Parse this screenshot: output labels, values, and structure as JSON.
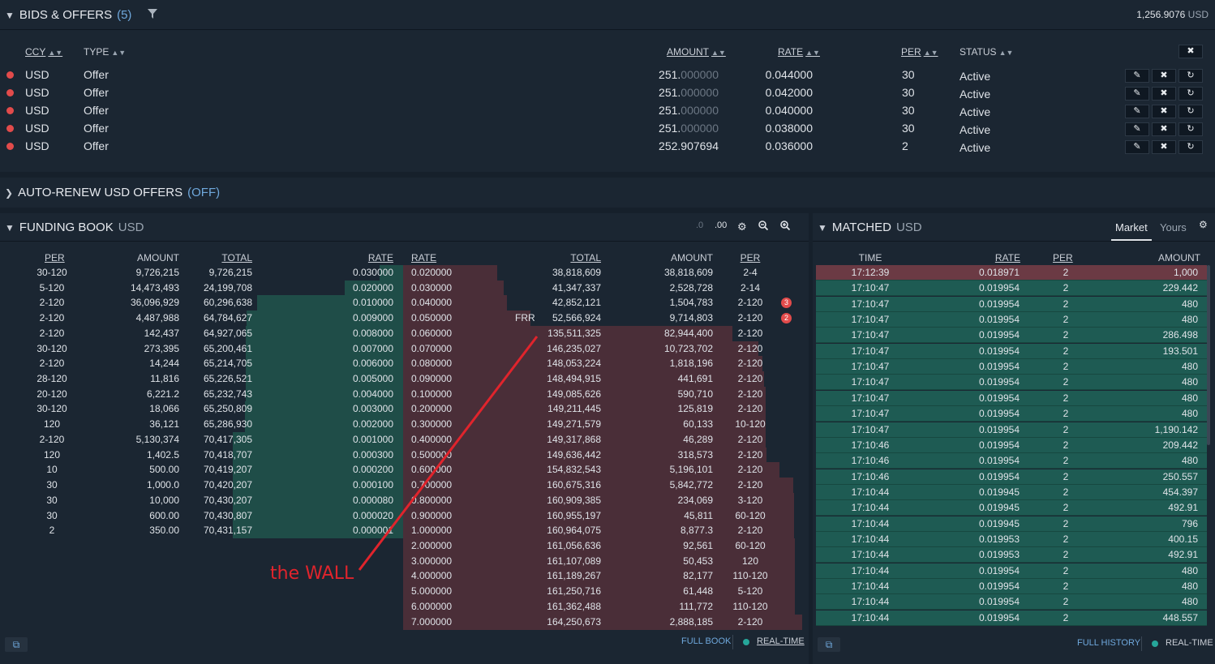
{
  "bids_offers": {
    "title": "BIDS & OFFERS",
    "count": "(5)",
    "balance": "1,256.9076",
    "balance_unit": "USD",
    "columns": {
      "ccy": "CCY",
      "type": "TYPE",
      "amount": "AMOUNT",
      "rate": "RATE",
      "per": "PER",
      "status": "STATUS"
    },
    "rows": [
      {
        "ccy": "USD",
        "type": "Offer",
        "amount_int": "251.",
        "amount_dec": "000000",
        "rate": "0.044000",
        "per": "30",
        "status": "Active"
      },
      {
        "ccy": "USD",
        "type": "Offer",
        "amount_int": "251.",
        "amount_dec": "000000",
        "rate": "0.042000",
        "per": "30",
        "status": "Active"
      },
      {
        "ccy": "USD",
        "type": "Offer",
        "amount_int": "251.",
        "amount_dec": "000000",
        "rate": "0.040000",
        "per": "30",
        "status": "Active"
      },
      {
        "ccy": "USD",
        "type": "Offer",
        "amount_int": "251.",
        "amount_dec": "000000",
        "rate": "0.038000",
        "per": "30",
        "status": "Active"
      },
      {
        "ccy": "USD",
        "type": "Offer",
        "amount_int": "252.907694",
        "amount_dec": "",
        "rate": "0.036000",
        "per": "2",
        "status": "Active"
      }
    ]
  },
  "auto_renew": {
    "title": "AUTO-RENEW USD OFFERS",
    "state": "(OFF)"
  },
  "funding_book": {
    "title": "FUNDING BOOK",
    "currency": "USD",
    "precision_minus": ".0",
    "precision_plus": ".00",
    "bid_columns": {
      "per": "PER",
      "amount": "AMOUNT",
      "total": "TOTAL",
      "rate": "RATE"
    },
    "ask_columns": {
      "rate": "RATE",
      "total": "TOTAL",
      "amount": "AMOUNT",
      "per": "PER"
    },
    "bids": [
      {
        "per": "30-120",
        "amount": "9,726,215",
        "total": "9,726,215",
        "rate": "0.030000",
        "depth": 0.138
      },
      {
        "per": "5-120",
        "amount": "14,473,493",
        "total": "24,199,708",
        "rate": "0.020000",
        "depth": 0.344
      },
      {
        "per": "2-120",
        "amount": "36,096,929",
        "total": "60,296,638",
        "rate": "0.010000",
        "depth": 0.856
      },
      {
        "per": "2-120",
        "amount": "4,487,988",
        "total": "64,784,627",
        "rate": "0.009000",
        "depth": 0.92
      },
      {
        "per": "2-120",
        "amount": "142,437",
        "total": "64,927,065",
        "rate": "0.008000",
        "depth": 0.922
      },
      {
        "per": "30-120",
        "amount": "273,395",
        "total": "65,200,461",
        "rate": "0.007000",
        "depth": 0.926
      },
      {
        "per": "2-120",
        "amount": "14,244",
        "total": "65,214,705",
        "rate": "0.006000",
        "depth": 0.926
      },
      {
        "per": "28-120",
        "amount": "11,816",
        "total": "65,226,521",
        "rate": "0.005000",
        "depth": 0.926
      },
      {
        "per": "20-120",
        "amount": "6,221.2",
        "total": "65,232,743",
        "rate": "0.004000",
        "depth": 0.926
      },
      {
        "per": "30-120",
        "amount": "18,066",
        "total": "65,250,809",
        "rate": "0.003000",
        "depth": 0.927
      },
      {
        "per": "120",
        "amount": "36,121",
        "total": "65,286,930",
        "rate": "0.002000",
        "depth": 0.927
      },
      {
        "per": "2-120",
        "amount": "5,130,374",
        "total": "70,417,305",
        "rate": "0.001000",
        "depth": 1.0
      },
      {
        "per": "120",
        "amount": "1,402.5",
        "total": "70,418,707",
        "rate": "0.000300",
        "depth": 1.0
      },
      {
        "per": "10",
        "amount": "500.00",
        "total": "70,419,207",
        "rate": "0.000200",
        "depth": 1.0
      },
      {
        "per": "30",
        "amount": "1,000.0",
        "total": "70,420,207",
        "rate": "0.000100",
        "depth": 1.0
      },
      {
        "per": "30",
        "amount": "10,000",
        "total": "70,430,207",
        "rate": "0.000080",
        "depth": 1.0
      },
      {
        "per": "30",
        "amount": "600.00",
        "total": "70,430,807",
        "rate": "0.000020",
        "depth": 1.0
      },
      {
        "per": "2",
        "amount": "350.00",
        "total": "70,431,157",
        "rate": "0.000001",
        "depth": 1.0
      }
    ],
    "asks": [
      {
        "rate": "0.020000",
        "total": "38,818,609",
        "amount": "38,818,609",
        "per": "2-4",
        "depth": 0.236,
        "frr": "",
        "badge": ""
      },
      {
        "rate": "0.030000",
        "total": "41,347,337",
        "amount": "2,528,728",
        "per": "2-14",
        "depth": 0.252,
        "frr": "",
        "badge": ""
      },
      {
        "rate": "0.040000",
        "total": "42,852,121",
        "amount": "1,504,783",
        "per": "2-120",
        "depth": 0.261,
        "frr": "",
        "badge": "3"
      },
      {
        "rate": "0.050000",
        "total": "52,566,924",
        "amount": "9,714,803",
        "per": "2-120",
        "depth": 0.32,
        "frr": "FRR",
        "badge": "2"
      },
      {
        "rate": "0.060000",
        "total": "135,511,325",
        "amount": "82,944,400",
        "per": "2-120",
        "depth": 0.825,
        "frr": "",
        "badge": ""
      },
      {
        "rate": "0.070000",
        "total": "146,235,027",
        "amount": "10,723,702",
        "per": "2-120",
        "depth": 0.89,
        "frr": "",
        "badge": ""
      },
      {
        "rate": "0.080000",
        "total": "148,053,224",
        "amount": "1,818,196",
        "per": "2-120",
        "depth": 0.901,
        "frr": "",
        "badge": ""
      },
      {
        "rate": "0.090000",
        "total": "148,494,915",
        "amount": "441,691",
        "per": "2-120",
        "depth": 0.904,
        "frr": "",
        "badge": ""
      },
      {
        "rate": "0.100000",
        "total": "149,085,626",
        "amount": "590,710",
        "per": "2-120",
        "depth": 0.908,
        "frr": "",
        "badge": ""
      },
      {
        "rate": "0.200000",
        "total": "149,211,445",
        "amount": "125,819",
        "per": "2-120",
        "depth": 0.908,
        "frr": "",
        "badge": ""
      },
      {
        "rate": "0.300000",
        "total": "149,271,579",
        "amount": "60,133",
        "per": "10-120",
        "depth": 0.909,
        "frr": "",
        "badge": ""
      },
      {
        "rate": "0.400000",
        "total": "149,317,868",
        "amount": "46,289",
        "per": "2-120",
        "depth": 0.909,
        "frr": "",
        "badge": ""
      },
      {
        "rate": "0.500000",
        "total": "149,636,442",
        "amount": "318,573",
        "per": "2-120",
        "depth": 0.911,
        "frr": "",
        "badge": ""
      },
      {
        "rate": "0.600000",
        "total": "154,832,543",
        "amount": "5,196,101",
        "per": "2-120",
        "depth": 0.943,
        "frr": "",
        "badge": ""
      },
      {
        "rate": "0.700000",
        "total": "160,675,316",
        "amount": "5,842,772",
        "per": "2-120",
        "depth": 0.978,
        "frr": "",
        "badge": ""
      },
      {
        "rate": "0.800000",
        "total": "160,909,385",
        "amount": "234,069",
        "per": "3-120",
        "depth": 0.98,
        "frr": "",
        "badge": ""
      },
      {
        "rate": "0.900000",
        "total": "160,955,197",
        "amount": "45,811",
        "per": "60-120",
        "depth": 0.98,
        "frr": "",
        "badge": ""
      },
      {
        "rate": "1.000000",
        "total": "160,964,075",
        "amount": "8,877.3",
        "per": "2-120",
        "depth": 0.98,
        "frr": "",
        "badge": ""
      },
      {
        "rate": "2.000000",
        "total": "161,056,636",
        "amount": "92,561",
        "per": "60-120",
        "depth": 0.981,
        "frr": "",
        "badge": ""
      },
      {
        "rate": "3.000000",
        "total": "161,107,089",
        "amount": "50,453",
        "per": "120",
        "depth": 0.981,
        "frr": "",
        "badge": ""
      },
      {
        "rate": "4.000000",
        "total": "161,189,267",
        "amount": "82,177",
        "per": "110-120",
        "depth": 0.981,
        "frr": "",
        "badge": ""
      },
      {
        "rate": "5.000000",
        "total": "161,250,716",
        "amount": "61,448",
        "per": "5-120",
        "depth": 0.982,
        "frr": "",
        "badge": ""
      },
      {
        "rate": "6.000000",
        "total": "161,362,488",
        "amount": "111,772",
        "per": "110-120",
        "depth": 0.982,
        "frr": "",
        "badge": ""
      },
      {
        "rate": "7.000000",
        "total": "164,250,673",
        "amount": "2,888,185",
        "per": "2-120",
        "depth": 1.0,
        "frr": "",
        "badge": ""
      }
    ],
    "annotation": "the WALL",
    "footer_full_book": "FULL BOOK",
    "footer_realtime": "REAL-TIME"
  },
  "matched": {
    "title": "MATCHED",
    "currency": "USD",
    "tab_market": "Market",
    "tab_yours": "Yours",
    "columns": {
      "time": "TIME",
      "rate": "RATE",
      "per": "PER",
      "amount": "AMOUNT"
    },
    "rows": [
      {
        "time": "17:12:39",
        "rate": "0.018971",
        "per": "2",
        "amount": "1,000",
        "side": "sell"
      },
      {
        "time": "17:10:47",
        "rate": "0.019954",
        "per": "2",
        "amount": "229.442",
        "side": "buy"
      },
      {
        "time": "17:10:47",
        "rate": "0.019954",
        "per": "2",
        "amount": "480",
        "side": "buy"
      },
      {
        "time": "17:10:47",
        "rate": "0.019954",
        "per": "2",
        "amount": "480",
        "side": "buy"
      },
      {
        "time": "17:10:47",
        "rate": "0.019954",
        "per": "2",
        "amount": "286.498",
        "side": "buy"
      },
      {
        "time": "17:10:47",
        "rate": "0.019954",
        "per": "2",
        "amount": "193.501",
        "side": "buy"
      },
      {
        "time": "17:10:47",
        "rate": "0.019954",
        "per": "2",
        "amount": "480",
        "side": "buy"
      },
      {
        "time": "17:10:47",
        "rate": "0.019954",
        "per": "2",
        "amount": "480",
        "side": "buy"
      },
      {
        "time": "17:10:47",
        "rate": "0.019954",
        "per": "2",
        "amount": "480",
        "side": "buy"
      },
      {
        "time": "17:10:47",
        "rate": "0.019954",
        "per": "2",
        "amount": "480",
        "side": "buy"
      },
      {
        "time": "17:10:47",
        "rate": "0.019954",
        "per": "2",
        "amount": "1,190.142",
        "side": "buy"
      },
      {
        "time": "17:10:46",
        "rate": "0.019954",
        "per": "2",
        "amount": "209.442",
        "side": "buy"
      },
      {
        "time": "17:10:46",
        "rate": "0.019954",
        "per": "2",
        "amount": "480",
        "side": "buy"
      },
      {
        "time": "17:10:46",
        "rate": "0.019954",
        "per": "2",
        "amount": "250.557",
        "side": "buy"
      },
      {
        "time": "17:10:44",
        "rate": "0.019945",
        "per": "2",
        "amount": "454.397",
        "side": "buy"
      },
      {
        "time": "17:10:44",
        "rate": "0.019945",
        "per": "2",
        "amount": "492.91",
        "side": "buy"
      },
      {
        "time": "17:10:44",
        "rate": "0.019945",
        "per": "2",
        "amount": "796",
        "side": "buy"
      },
      {
        "time": "17:10:44",
        "rate": "0.019953",
        "per": "2",
        "amount": "400.15",
        "side": "buy"
      },
      {
        "time": "17:10:44",
        "rate": "0.019953",
        "per": "2",
        "amount": "492.91",
        "side": "buy"
      },
      {
        "time": "17:10:44",
        "rate": "0.019954",
        "per": "2",
        "amount": "480",
        "side": "buy"
      },
      {
        "time": "17:10:44",
        "rate": "0.019954",
        "per": "2",
        "amount": "480",
        "side": "buy"
      },
      {
        "time": "17:10:44",
        "rate": "0.019954",
        "per": "2",
        "amount": "480",
        "side": "buy"
      },
      {
        "time": "17:10:44",
        "rate": "0.019954",
        "per": "2",
        "amount": "448.557",
        "side": "buy"
      }
    ],
    "footer_full_history": "FULL HISTORY",
    "footer_realtime": "REAL-TIME"
  },
  "colors": {
    "bid": "#1f4d48",
    "ask": "#4a2e38",
    "matched_buy": "#1e5b53",
    "matched_sell": "#6b3a44",
    "accent": "#6fa8dc",
    "dot": "#e24b4b",
    "annotation": "#e0242c"
  }
}
